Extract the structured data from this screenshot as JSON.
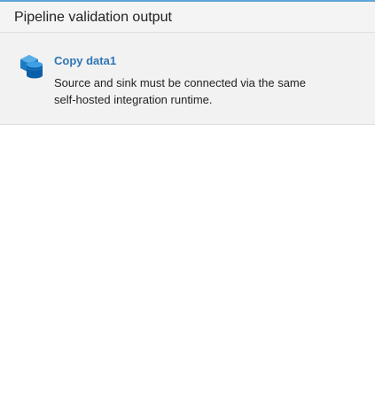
{
  "panel": {
    "title": "Pipeline validation output"
  },
  "results": [
    {
      "icon": "copy-data-icon",
      "activity_name": "Copy data1",
      "message_line1": "Source and sink must be connected via the same",
      "message_line2": "self-hosted integration runtime."
    }
  ],
  "colors": {
    "accent": "#2e75b6",
    "header_bg": "#f4f4f4",
    "item_bg": "#f2f2f2",
    "top_border": "#5fa3d8"
  }
}
